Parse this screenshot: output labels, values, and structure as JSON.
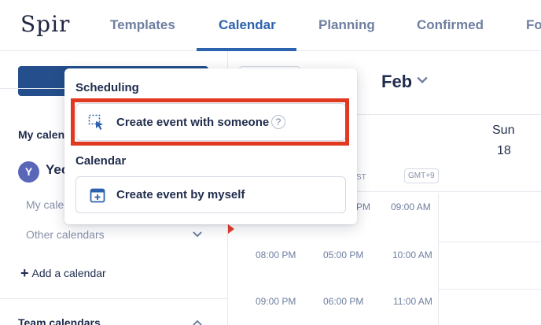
{
  "app": {
    "logo": "Spir"
  },
  "nav": {
    "tabs": [
      {
        "label": "Templates",
        "active": false
      },
      {
        "label": "Calendar",
        "active": true
      },
      {
        "label": "Planning",
        "active": false
      },
      {
        "label": "Confirmed",
        "active": false
      },
      {
        "label": "Fo",
        "active": false
      }
    ]
  },
  "sidebar": {
    "my_calendars_title": "My calen",
    "user": {
      "initial": "Y",
      "name": "Yeo"
    },
    "my_cal_item": "My cale",
    "other_calendars": "Other calendars",
    "add_calendar": "Add a calendar",
    "team_calendars_title": "Team calendars"
  },
  "calendar": {
    "month": "Feb",
    "day": {
      "name": "Sun",
      "number": "18"
    },
    "timezones": {
      "partial_label": "ST",
      "badge": "GMT+9"
    },
    "time_rows": [
      {
        "col1": "",
        "col2": "PM",
        "col3": "09:00 AM"
      },
      {
        "col1": "08:00 PM",
        "col2": "05:00 PM",
        "col3": "10:00 AM"
      },
      {
        "col1": "09:00 PM",
        "col2": "06:00 PM",
        "col3": "11:00 AM"
      }
    ]
  },
  "popup": {
    "scheduling_heading": "Scheduling",
    "option_with_someone": {
      "label": "Create event with someone",
      "help": "?"
    },
    "calendar_heading": "Calendar",
    "option_by_myself": {
      "label": "Create event by myself"
    }
  },
  "colors": {
    "accent": "#2d63ae",
    "primary_button": "#244f8c",
    "highlight": "#e0391f",
    "now_marker": "#e5392b",
    "avatar": "#5a66b8"
  }
}
